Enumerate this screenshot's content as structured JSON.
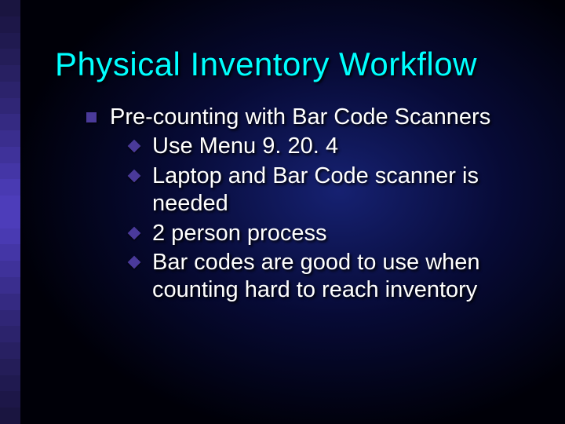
{
  "title": "Physical Inventory Workflow",
  "bullet": {
    "text": "Pre-counting with Bar Code Scanners",
    "subs": [
      "Use Menu 9. 20. 4",
      "Laptop and Bar Code scanner is needed",
      "2 person process",
      "Bar codes are good to use when counting hard to reach inventory"
    ]
  },
  "stripe_colors": [
    "#1a1540",
    "#1d1748",
    "#201a50",
    "#241d58",
    "#282062",
    "#2c236c",
    "#302676",
    "#352a82",
    "#3a2e8e",
    "#3f329a",
    "#4436a6",
    "#493ab2",
    "#4d3dba",
    "#4d3dba",
    "#493ab2",
    "#4436a6",
    "#3f329a",
    "#3a2e8e",
    "#352a82",
    "#302676",
    "#2c236c",
    "#282062",
    "#241d58",
    "#201a50",
    "#1d1748",
    "#1a1540"
  ]
}
